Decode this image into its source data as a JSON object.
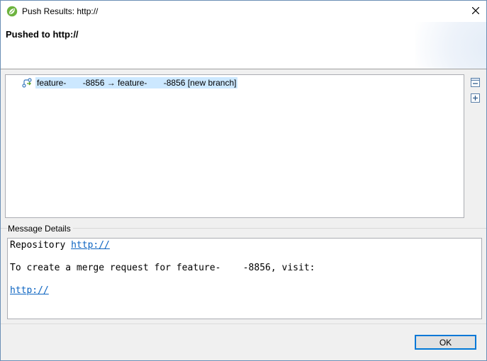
{
  "window": {
    "title": "Push Results: http://"
  },
  "header": {
    "title": "Pushed to http://"
  },
  "results": {
    "rows": [
      {
        "label": "feature-       -8856 → feature-       -8856 [new branch]",
        "icon": "push-branch-icon"
      }
    ]
  },
  "side_buttons": {
    "collapse": "collapse-all-icon",
    "expand": "expand-all-icon"
  },
  "message": {
    "label": "Message Details",
    "line1_prefix": "Repository ",
    "line1_link": "http://",
    "line2": "To create a merge request for feature-    -8856, visit:",
    "line3_link": "http://"
  },
  "footer": {
    "ok_label": "OK"
  },
  "colors": {
    "selection": "#cce8ff",
    "link": "#0b63c1",
    "accent": "#0078d7"
  }
}
